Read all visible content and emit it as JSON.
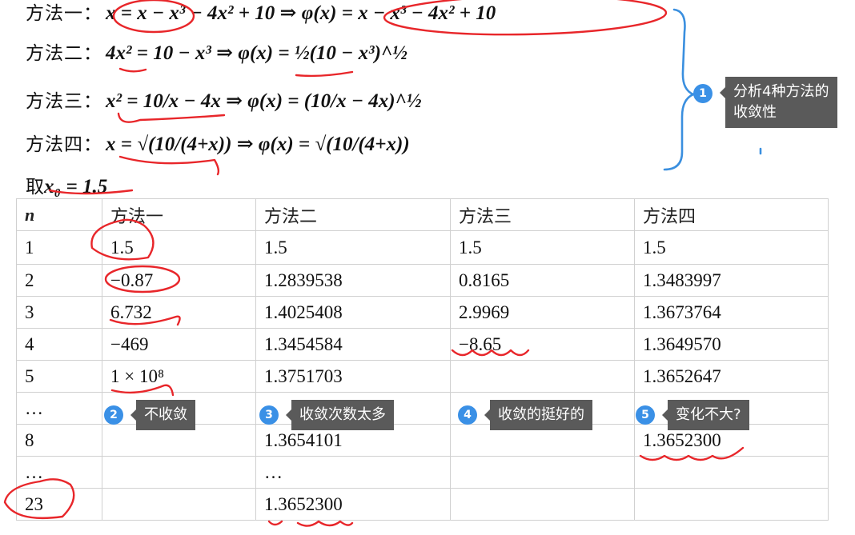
{
  "methods": [
    {
      "label": "方法一：",
      "formula": "x = x − x³ − 4x² + 10 ⇒ φ(x) = x − x³ − 4x² + 10"
    },
    {
      "label": "方法二：",
      "formula": "4x² = 10 − x³ ⇒ φ(x) = ½(10 − x³)^½"
    },
    {
      "label": "方法三：",
      "formula": "x² = 10/x − 4x ⇒ φ(x) = (10/x − 4x)^½"
    },
    {
      "label": "方法四：",
      "formula": "x = √(10/(4+x)) ⇒ φ(x) = √(10/(4+x))"
    }
  ],
  "initial": {
    "label": "取",
    "formula": "x₀ = 1.5"
  },
  "table": {
    "headers": [
      "n",
      "方法一",
      "方法二",
      "方法三",
      "方法四"
    ],
    "rows": [
      [
        "1",
        "1.5",
        "1.5",
        "1.5",
        "1.5"
      ],
      [
        "2",
        "−0.87",
        "1.2839538",
        "0.8165",
        "1.3483997"
      ],
      [
        "3",
        "6.732",
        "1.4025408",
        "2.9969",
        "1.3673764"
      ],
      [
        "4",
        "−469",
        "1.3454584",
        "−8.65",
        "1.3649570"
      ],
      [
        "5",
        "1 × 10⁸",
        "1.3751703",
        "",
        "1.3652647"
      ],
      [
        "…",
        "",
        "",
        "",
        ""
      ],
      [
        "8",
        "",
        "1.3654101",
        "",
        "1.3652300"
      ],
      [
        "…",
        "",
        "…",
        "",
        ""
      ],
      [
        "23",
        "",
        "1.3652300",
        "",
        ""
      ]
    ]
  },
  "annotations": [
    {
      "num": "1",
      "text": "分析4种方法的收敛性"
    },
    {
      "num": "2",
      "text": "不收敛"
    },
    {
      "num": "3",
      "text": "收敛次数太多"
    },
    {
      "num": "4",
      "text": "收敛的挺好的"
    },
    {
      "num": "5",
      "text": "变化不大?"
    }
  ],
  "colors": {
    "ink": "#e8262a",
    "bracket": "#3a8fdf",
    "badge": "#3a90e6",
    "tooltip": "#5a5a5a"
  }
}
